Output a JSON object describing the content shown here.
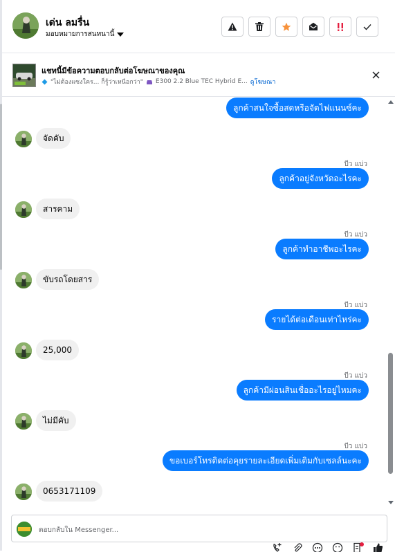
{
  "header": {
    "contact_name": "เด่น ลมรื่น",
    "assign_label": "มอบหมายการสนทนานี้",
    "actions": [
      "spam-warning",
      "delete",
      "star",
      "mark-unread",
      "important",
      "done"
    ]
  },
  "ad": {
    "title": "แชทนี้มีข้อความตอบกลับต่อโฆษณาของคุณ",
    "subtitle": "\"ไม่ต้องแซงใคร... ก็รู้ว่าเหนือกว่า\"",
    "model": "E300 2.2 Blue TEC Hybrid E...",
    "link": "ดูโฆษณา"
  },
  "messages": [
    {
      "dir": "out",
      "sender": "บีว แบ่ว",
      "text": "ลูกค้าสนใจซื้อสดหรือจัดไฟแนนซ์คะ"
    },
    {
      "dir": "in",
      "text": "จัดคับ"
    },
    {
      "dir": "out",
      "sender": "บีว แบ่ว",
      "text": "ลูกค้าอยู่จังหวัดอะไรคะ"
    },
    {
      "dir": "in",
      "text": "สารคาม"
    },
    {
      "dir": "out",
      "sender": "บีว แบ่ว",
      "text": "ลูกค้าทำอาชีพอะไรคะ"
    },
    {
      "dir": "in",
      "text": "ขับรถโดยสาร"
    },
    {
      "dir": "out",
      "sender": "บีว แบ่ว",
      "text": "รายได้ต่อเดือนเท่าไหร่คะ"
    },
    {
      "dir": "in",
      "text": "25,000"
    },
    {
      "dir": "out",
      "sender": "บีว แบ่ว",
      "text": "ลูกค้ามีผ่อนสินเชื่ออะไรอยู่ไหมคะ"
    },
    {
      "dir": "in",
      "text": "ไม่มีคับ"
    },
    {
      "dir": "out",
      "sender": "บีว แบ่ว",
      "text": "ขอเบอร์โทรติดต่อคุยรายละเอียดเพิ่มเติมกับเซลล์นะคะ"
    },
    {
      "dir": "in",
      "text": "0653171109"
    }
  ],
  "composer": {
    "placeholder": "ตอบกลับใน Messenger..."
  },
  "colors": {
    "outgoing_bubble": "#0a7cff",
    "incoming_bubble": "#f0f0f0",
    "link": "#0064d1",
    "star": "#f7923b",
    "important": "#e41e3f"
  }
}
